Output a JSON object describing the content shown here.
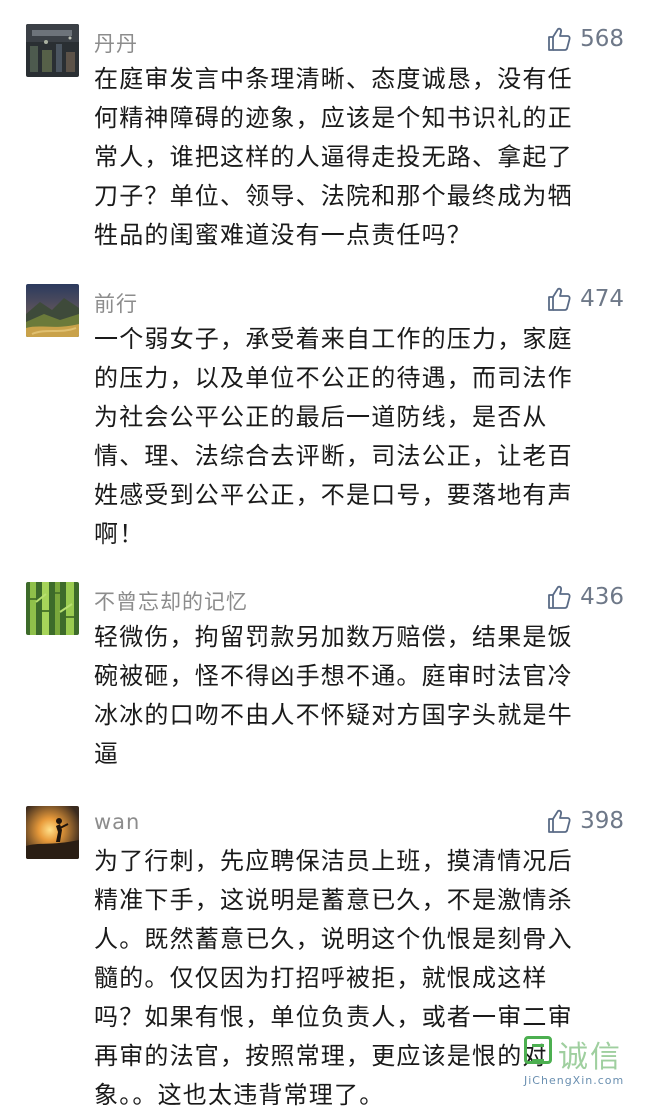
{
  "comments": [
    {
      "username": "丹丹",
      "avatar_icon": "dark-night-photo-avatar",
      "likes": "568",
      "lines": [
        "在庭审发言中条理清晰、态度诚恳，没有任",
        "何精神障碍的迹象，应该是个知书识礼的正",
        "常人，谁把这样的人逼得走投无路、拿起了",
        "刀子？单位、领导、法院和那个最终成为牺",
        "牲品的闺蜜难道没有一点责任吗？"
      ]
    },
    {
      "username": "前行",
      "avatar_icon": "mountain-landscape-avatar",
      "likes": "474",
      "lines": [
        "一个弱女子，承受着来自工作的压力，家庭",
        "的压力，以及单位不公正的待遇，而司法作",
        "为社会公平公正的最后一道防线，是否从",
        "情、理、法综合去评断，司法公正，让老百",
        "姓感受到公平公正，不是口号，要落地有声",
        "啊！"
      ]
    },
    {
      "username": "不曾忘却的记忆",
      "avatar_icon": "bamboo-avatar",
      "likes": "436",
      "lines": [
        "轻微伤，拘留罚款另加数万赔偿，结果是饭",
        "碗被砸，怪不得凶手想不通。庭审时法官冷",
        "冰冰的口吻不由人不怀疑对方国字头就是牛",
        "逼"
      ]
    },
    {
      "username": "wan",
      "avatar_icon": "sunset-silhouette-avatar",
      "likes": "398",
      "lines": [
        "为了行刺，先应聘保洁员上班，摸清情况后",
        "精准下手，这说明是蓄意已久，不是激情杀",
        "人。既然蓄意已久，说明这个仇恨是刻骨入",
        "髓的。仅仅因为打招呼被拒，就恨成这样",
        "吗？如果有恨，单位负责人，或者一审二审",
        "再审的法官，按照常理，更应该是恨的对",
        "象。。这也太违背常理了。"
      ]
    }
  ],
  "watermark": {
    "chars": "诚信",
    "url": "JiChengXin.com"
  },
  "colors": {
    "username": "#8c8c8c",
    "like_icon": "#5a6b86",
    "body_text": "#1a1a1a",
    "watermark_green": "#4caf50"
  }
}
